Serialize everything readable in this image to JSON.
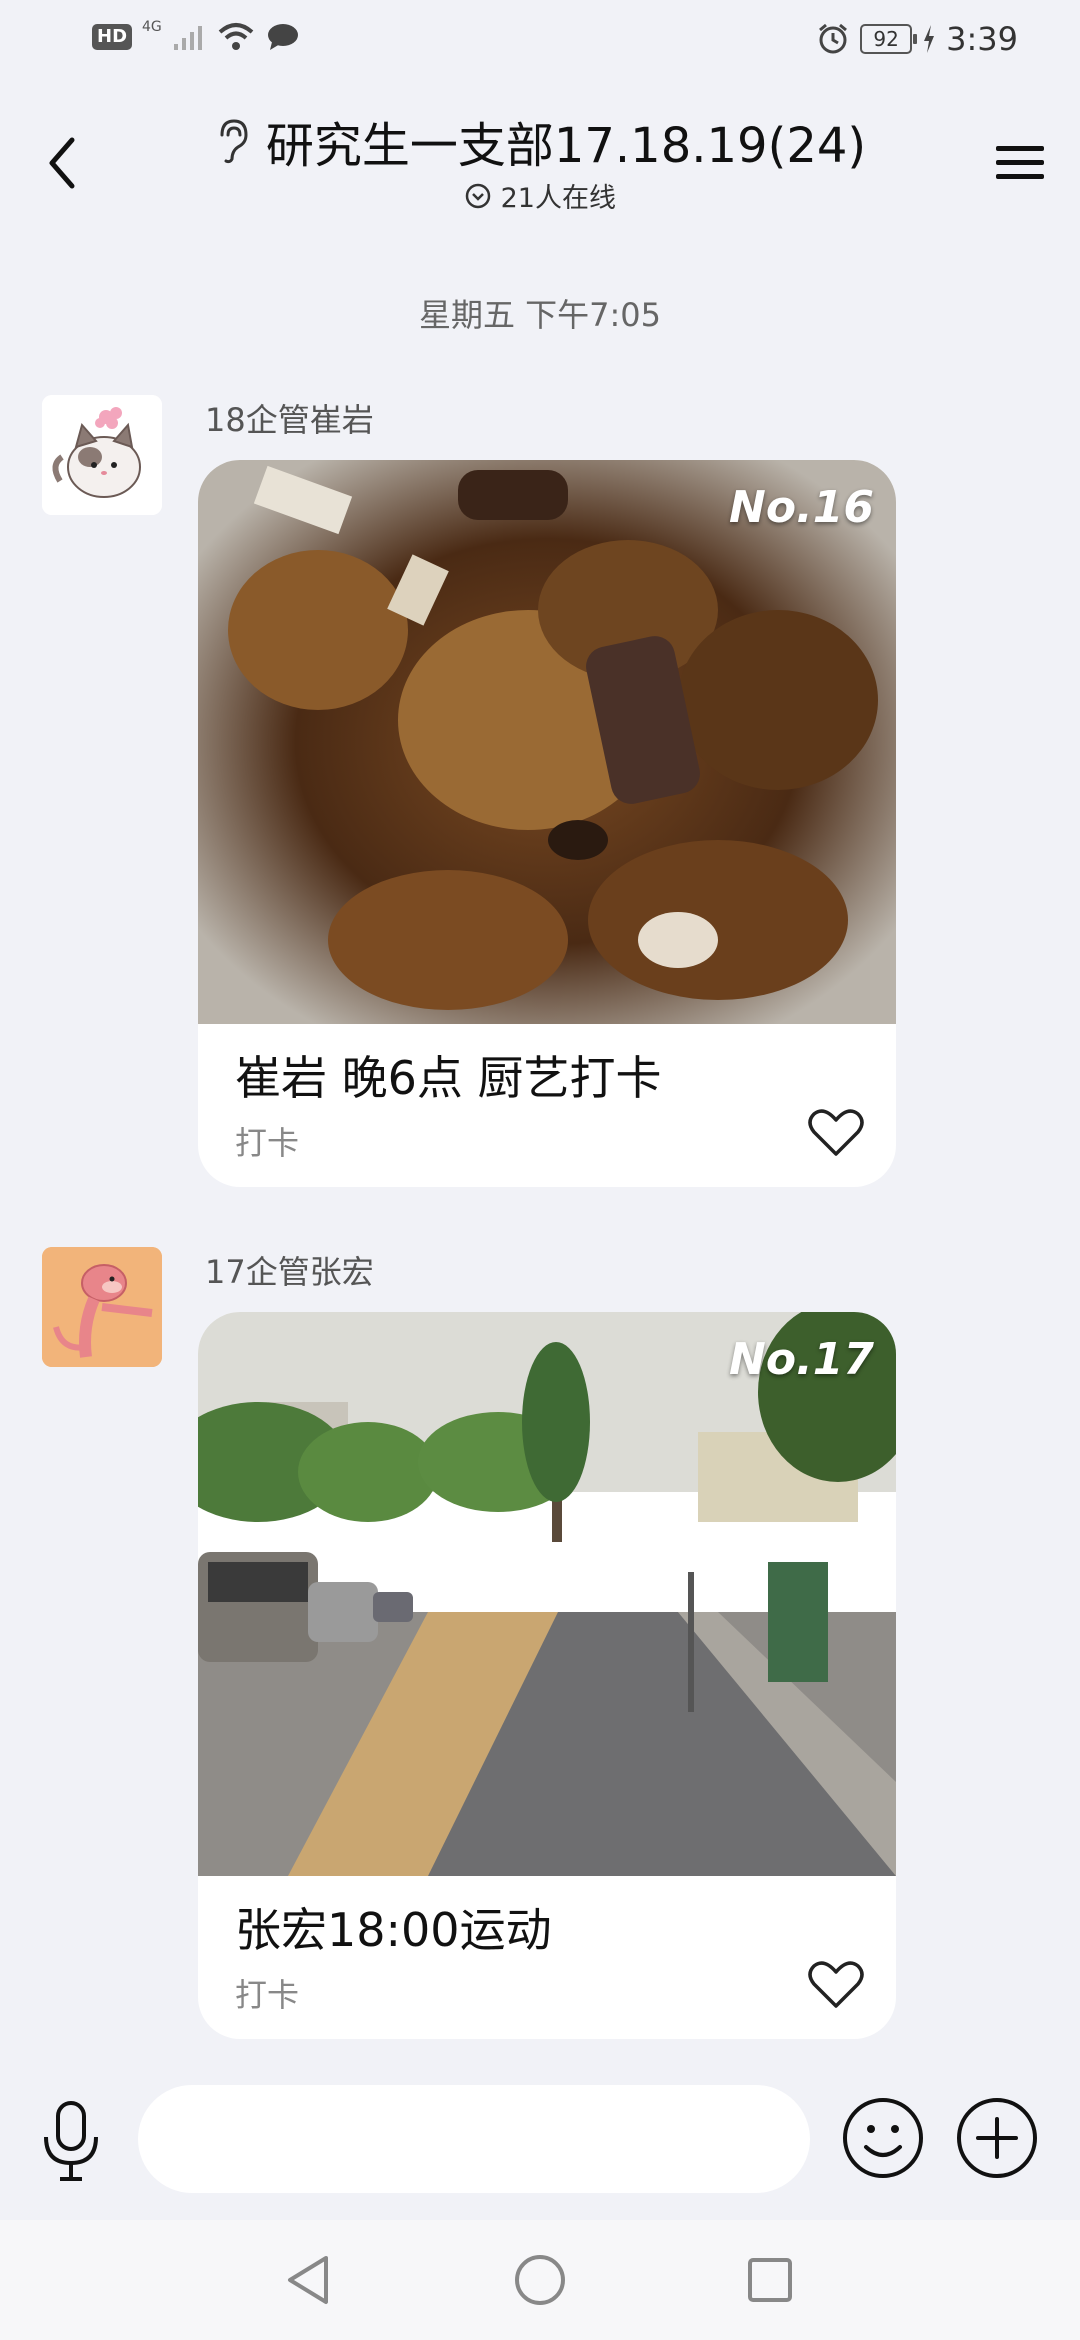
{
  "status_bar": {
    "hd": "HD",
    "network": "4G",
    "battery": "92",
    "time": "3:39"
  },
  "header": {
    "title": "研究生一支部17.18.19(24)",
    "online_status": "21人在线"
  },
  "timestamp": "星期五 下午7:05",
  "messages": [
    {
      "sender": "18企管崔岩",
      "badge": "No.16",
      "card_title": "崔岩 晚6点 厨艺打卡",
      "card_subtitle": "打卡"
    },
    {
      "sender": "17企管张宏",
      "badge": "No.17",
      "card_title": "张宏18:00运动",
      "card_subtitle": "打卡"
    }
  ],
  "input": {
    "value": "",
    "placeholder": ""
  },
  "colors": {
    "background": "#F1F2F7",
    "card": "#FFFFFF",
    "secondary_text": "#888888"
  }
}
